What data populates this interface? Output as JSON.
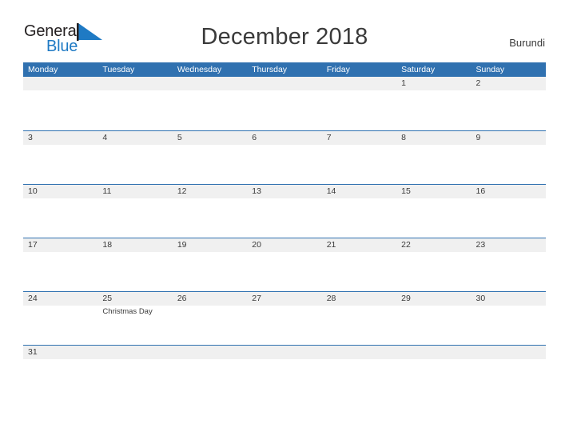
{
  "header": {
    "logo": {
      "text_top": "General",
      "text_bottom": "Blue",
      "sail_icon": "sail-triangle-icon",
      "brand_blue": "#1f7ac4",
      "brand_dark": "#231f20"
    },
    "title": "December 2018",
    "country": "Burundi"
  },
  "calendar": {
    "accent_color": "#3071b0",
    "band_color": "#f0f0f0",
    "weekdays": [
      "Monday",
      "Tuesday",
      "Wednesday",
      "Thursday",
      "Friday",
      "Saturday",
      "Sunday"
    ],
    "weeks": [
      [
        {
          "day": ""
        },
        {
          "day": ""
        },
        {
          "day": ""
        },
        {
          "day": ""
        },
        {
          "day": ""
        },
        {
          "day": "1"
        },
        {
          "day": "2"
        }
      ],
      [
        {
          "day": "3"
        },
        {
          "day": "4"
        },
        {
          "day": "5"
        },
        {
          "day": "6"
        },
        {
          "day": "7"
        },
        {
          "day": "8"
        },
        {
          "day": "9"
        }
      ],
      [
        {
          "day": "10"
        },
        {
          "day": "11"
        },
        {
          "day": "12"
        },
        {
          "day": "13"
        },
        {
          "day": "14"
        },
        {
          "day": "15"
        },
        {
          "day": "16"
        }
      ],
      [
        {
          "day": "17"
        },
        {
          "day": "18"
        },
        {
          "day": "19"
        },
        {
          "day": "20"
        },
        {
          "day": "21"
        },
        {
          "day": "22"
        },
        {
          "day": "23"
        }
      ],
      [
        {
          "day": "24"
        },
        {
          "day": "25",
          "event": "Christmas Day"
        },
        {
          "day": "26"
        },
        {
          "day": "27"
        },
        {
          "day": "28"
        },
        {
          "day": "29"
        },
        {
          "day": "30"
        }
      ],
      [
        {
          "day": "31"
        },
        {
          "day": ""
        },
        {
          "day": ""
        },
        {
          "day": ""
        },
        {
          "day": ""
        },
        {
          "day": ""
        },
        {
          "day": ""
        }
      ]
    ]
  }
}
